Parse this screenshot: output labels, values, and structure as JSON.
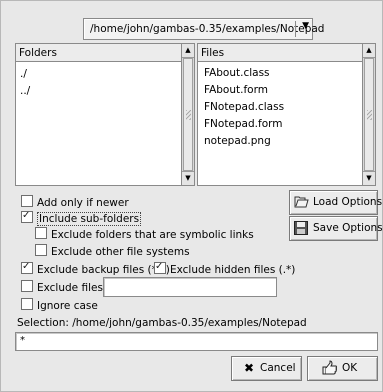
{
  "path": {
    "value": "/home/john/gambas-0.35/examples/Notepad"
  },
  "folders": {
    "header": "Folders",
    "items": [
      "./",
      "../"
    ]
  },
  "files": {
    "header": "Files",
    "items": [
      "FAbout.class",
      "FAbout.form",
      "FNotepad.class",
      "FNotepad.form",
      "notepad.png"
    ]
  },
  "options": {
    "add_only_newer": {
      "label": "Add only if newer",
      "checked": false
    },
    "include_subfolders": {
      "label": "Include sub-folders",
      "checked": true
    },
    "exclude_symlinks": {
      "label": "Exclude folders that are symbolic links",
      "checked": false
    },
    "exclude_other_fs": {
      "label": "Exclude other file systems",
      "checked": false
    },
    "exclude_backup": {
      "label": "Exclude backup files (*~)",
      "checked": true
    },
    "exclude_hidden": {
      "label": "Exclude hidden files (.*)",
      "checked": true
    },
    "exclude_files": {
      "label": "Exclude files:",
      "checked": false,
      "value": ""
    },
    "ignore_case": {
      "label": "Ignore case",
      "checked": false
    }
  },
  "buttons": {
    "load_options": "Load Options",
    "save_options": "Save Options",
    "cancel": "Cancel",
    "ok": "OK"
  },
  "selection": {
    "label": "Selection: /home/john/gambas-0.35/examples/Notepad",
    "value": "*"
  }
}
